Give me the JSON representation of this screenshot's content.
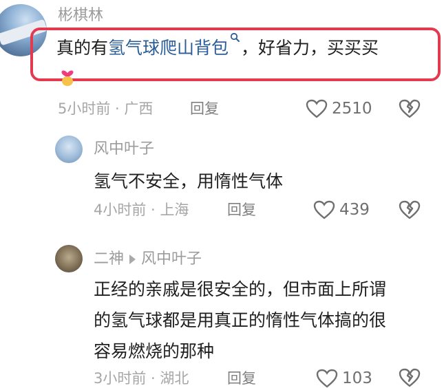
{
  "comment": {
    "username": "彬棋林",
    "text_before": "真的有",
    "link_text": "氢气球爬山背包",
    "text_after": "，好省力，买买买",
    "time": "5小时前",
    "location": "广西",
    "reply_label": "回复",
    "likes": "2510"
  },
  "replies": [
    {
      "username": "风中叶子",
      "text": "氢气不安全，用惰性气体",
      "time": "4小时前",
      "location": "上海",
      "reply_label": "回复",
      "likes": "439"
    },
    {
      "username": "二神",
      "reply_to": "风中叶子",
      "text_line1": "正经的亲戚是很安全的，但市面上所谓",
      "text_line2": "的氢气球都是用真正的惰性气体搞的很",
      "text_line3": "容易燃烧的那种",
      "time": "3小时前",
      "location": "湖北",
      "reply_label": "回复",
      "likes": "103"
    }
  ],
  "colors": {
    "highlight": "#e23a4e",
    "link": "#2b5d98"
  },
  "icons": [
    "heart-icon",
    "dislike-broken-heart-icon",
    "search-icon",
    "play-arrow-icon",
    "emoji-heart-hand-icon"
  ]
}
